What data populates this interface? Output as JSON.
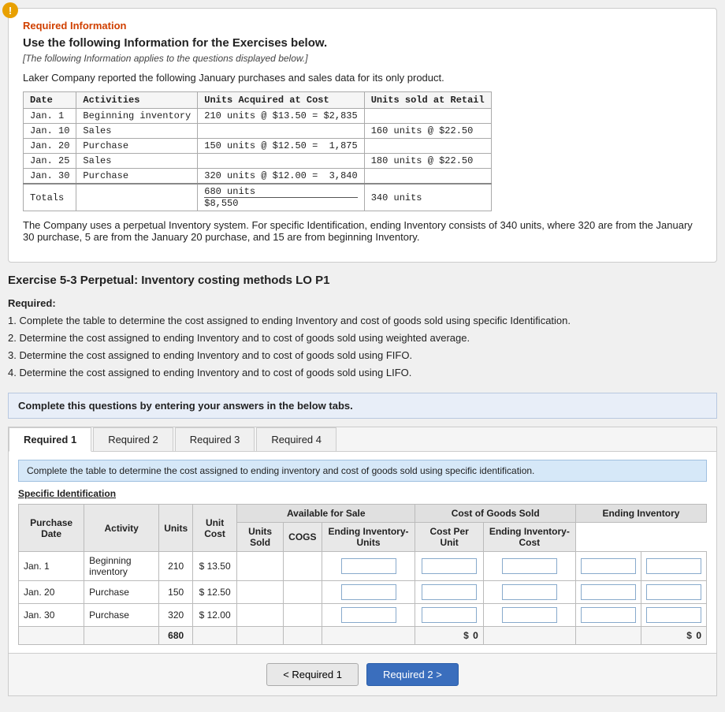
{
  "infoBox": {
    "iconLabel": "!",
    "sectionTitle": "Required Information",
    "mainTitle": "Use the following Information for the Exercises below.",
    "subtitle": "[The following Information applies to the questions displayed below.]",
    "desc": "Laker Company reported the following January purchases and sales data for its only product.",
    "tableHeaders": {
      "date": "Date",
      "activities": "Activities",
      "unitsAcquired": "Units Acquired at Cost",
      "unitsSold": "Units sold at Retail"
    },
    "tableRows": [
      {
        "date": "Jan. 1",
        "activity": "Beginning inventory",
        "acquired": "210 units @ $13.50 = $2,835",
        "sold": ""
      },
      {
        "date": "Jan. 10",
        "activity": "Sales",
        "acquired": "",
        "sold": "160 units @ $22.50"
      },
      {
        "date": "Jan. 20",
        "activity": "Purchase",
        "acquired": "150 units @ $12.50 =  1,875",
        "sold": ""
      },
      {
        "date": "Jan. 25",
        "activity": "Sales",
        "acquired": "",
        "sold": "180 units @ $22.50"
      },
      {
        "date": "Jan. 30",
        "activity": "Purchase",
        "acquired": "320 units @ $12.00 =  3,840",
        "sold": ""
      },
      {
        "date": "Totals",
        "activity": "",
        "acquired_units": "680 units",
        "acquired_total": "$8,550",
        "sold_units": "340 units"
      }
    ],
    "footnote": "The Company uses a perpetual Inventory system. For specific Identification, ending Inventory consists of 340 units, where 320 are from the January 30 purchase, 5 are from the January 20 purchase, and 15 are from beginning Inventory."
  },
  "exercise": {
    "title": "Exercise 5-3 Perpetual: Inventory costing methods LO P1",
    "requiredLabel": "Required:",
    "requiredItems": [
      "1. Complete the table to determine the cost assigned to ending Inventory and cost of goods sold using specific Identification.",
      "2. Determine the cost assigned to ending Inventory and to cost of goods sold using weighted average.",
      "3. Determine the cost assigned to ending Inventory and to cost of goods sold using FIFO.",
      "4. Determine the cost assigned to ending Inventory and to cost of goods sold using LIFO."
    ],
    "instructionBar": "Complete this questions by entering your answers in the below tabs.",
    "tabs": [
      {
        "label": "Required 1",
        "active": true
      },
      {
        "label": "Required 2",
        "active": false
      },
      {
        "label": "Required 3",
        "active": false
      },
      {
        "label": "Required 4",
        "active": false
      }
    ],
    "blueInfo": "Complete the table to determine the cost assigned to ending inventory and cost of goods sold using specific identification.",
    "sectionLabel": "Specific Identification",
    "tableHeaders": {
      "purchaseDate": "Purchase Date",
      "activity": "Activity",
      "units": "Units",
      "unitCost": "Unit Cost",
      "availableForSale": "Available for Sale",
      "costOfGoodsSold": "Cost of Goods Sold",
      "endingInventory": "Ending Inventory",
      "unitsSold": "Units Sold",
      "cogs": "COGS",
      "endingUnits": "Ending Inventory- Units",
      "costPerUnit": "Cost Per Unit",
      "endingCost": "Ending Inventory- Cost"
    },
    "tableRows": [
      {
        "date": "Jan. 1",
        "activity": "Beginning inventory",
        "units": "210",
        "unitCost": "$ 13.50",
        "unitsSold": "",
        "cogs": "",
        "endingUnits": "",
        "costPerUnit": "",
        "endingCost": ""
      },
      {
        "date": "Jan. 20",
        "activity": "Purchase",
        "units": "150",
        "unitCost": "$ 12.50",
        "unitsSold": "",
        "cogs": "",
        "endingUnits": "",
        "costPerUnit": "",
        "endingCost": ""
      },
      {
        "date": "Jan. 30",
        "activity": "Purchase",
        "units": "320",
        "unitCost": "$ 12.00",
        "unitsSold": "",
        "cogs": "",
        "endingUnits": "",
        "costPerUnit": "",
        "endingCost": ""
      }
    ],
    "totalsRow": {
      "units": "680",
      "cogsTotal": "0",
      "endingTotal": "0"
    }
  },
  "navigation": {
    "prevLabel": "< Required 1",
    "nextLabel": "Required 2 >"
  }
}
